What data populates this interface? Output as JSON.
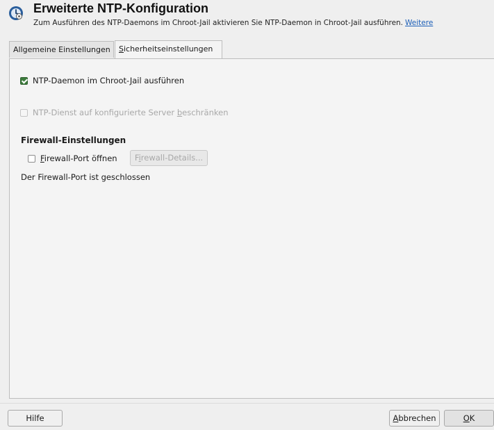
{
  "header": {
    "title": "Erweiterte NTP-Konfiguration",
    "subtitle": "Zum Ausführen des NTP-Daemons im Chroot-Jail aktivieren Sie NTP-Daemon in Chroot-Jail ausführen.",
    "more_link": "Weitere",
    "icon": "ntp-clock-icon"
  },
  "tabs": [
    {
      "label": "Allgemeine Einstellungen",
      "active": false
    },
    {
      "label_pre": "",
      "label_mnemonic": "S",
      "label_post": "icherheitseinstellungen",
      "active": true
    }
  ],
  "security": {
    "chroot": {
      "pre": "NTP-Daemon im Chroot-",
      "mnemonic": "J",
      "post": "ail ausführen",
      "checked": true
    },
    "restrict": {
      "pre": "NTP-Dienst auf konfigurierte Server ",
      "mnemonic": "b",
      "post": "eschränken",
      "checked": false,
      "enabled": false
    }
  },
  "firewall": {
    "heading": "Firewall-Einstellungen",
    "open_port": {
      "pre": "",
      "mnemonic": "F",
      "post": "irewall-Port öffnen",
      "checked": false
    },
    "details_button": {
      "pre": "F",
      "mnemonic": "i",
      "post": "rewall-Details...",
      "enabled": false
    },
    "status": "Der Firewall-Port ist geschlossen"
  },
  "footer": {
    "help": "Hilfe",
    "cancel": {
      "mnemonic": "A",
      "post": "bbrechen"
    },
    "ok": {
      "mnemonic": "O",
      "post": "K"
    }
  },
  "colors": {
    "checkbox_checked": "#3c7c3c",
    "link": "#1d5fb8"
  }
}
